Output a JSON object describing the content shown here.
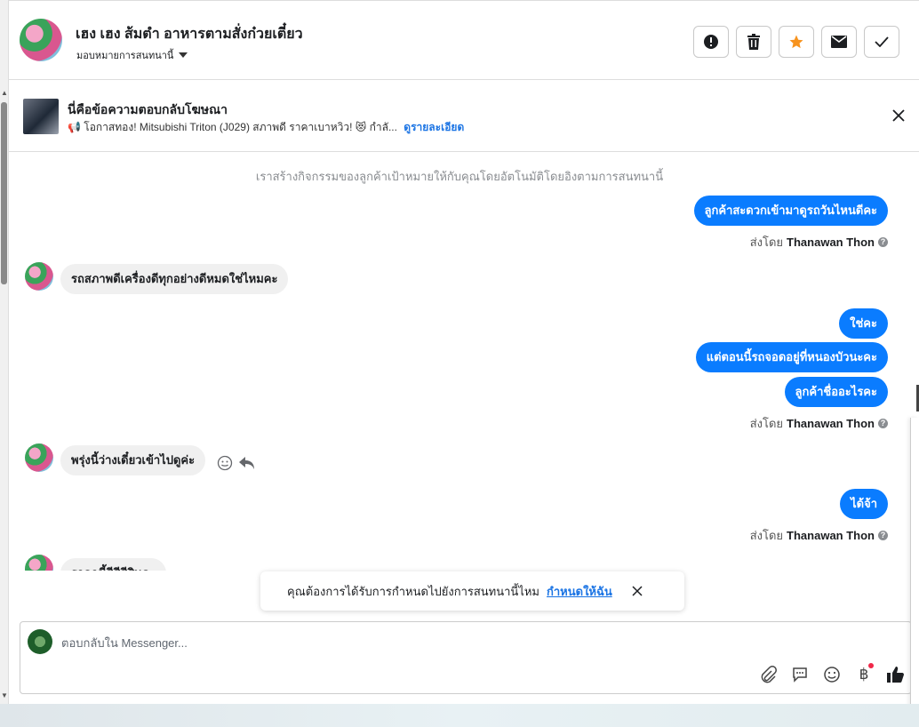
{
  "header": {
    "name": "เฮง เฮง ส้มตำ อาหารตามสั่งก๋วยเตี๋ยว",
    "assign_label": "มอบหมายการสนทนานี้",
    "actions": [
      "report-icon",
      "trash-icon",
      "star-icon",
      "mail-icon",
      "check-icon"
    ]
  },
  "ad": {
    "title": "นี่คือข้อความตอบกลับโฆษณา",
    "desc": "📢 โอกาสทอง! Mitsubishi Triton (J029) สภาพดี ราคาเบาหวิว! 😻 กำลั...",
    "link": "ดูรายละเอียด"
  },
  "chat": {
    "system_note": "เราสร้างกิจกรรมของลูกค้าเป้าหมายให้กับคุณโดยอัตโนมัติโดยอิงตามการสนทนานี้",
    "sent_by_prefix": "ส่งโดย",
    "agent_name": "Thanawan Thon",
    "messages": {
      "out1": "ลูกค้าสะดวกเข้ามาดูรถวันไหนดีคะ",
      "in1": "รถสภาพดีเครื่องดีทุกอย่างดีหมดใช่ไหมคะ",
      "out2": "ใช่คะ",
      "out3": "แต่ตอนนี้รถจอดอยู่ที่หนองบัวนะคะ",
      "out4": "ลูกค้าชื่ออะไรคะ",
      "in2": "พรุ่งนี้ว่างเดี๋ยวเข้าไปดูค่ะ",
      "out5": "ได้จ้า",
      "in3": "ราคาขี้สีสีสีสินคะ"
    }
  },
  "suggestion": {
    "text": "คุณต้องการได้รับการกำหนดไปยังการสนทนานี้ไหม",
    "link": "กำหนดให้ฉัน"
  },
  "composer": {
    "placeholder": "ตอบกลับใน Messenger..."
  },
  "colors": {
    "accent": "#0a7cff",
    "link": "#1b74e4",
    "incoming_bubble": "#f0f0f0"
  }
}
